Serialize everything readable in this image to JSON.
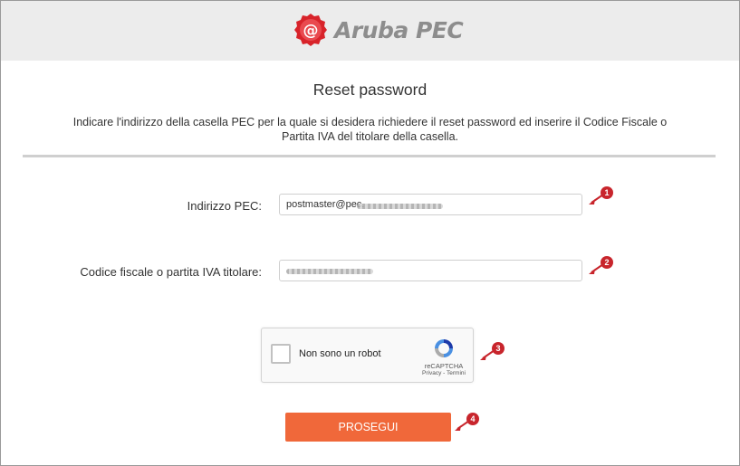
{
  "brand": {
    "name": "Aruba PEC",
    "logo_icon": "at-sign-seal-icon"
  },
  "page": {
    "title": "Reset password",
    "instructions": "Indicare l'indirizzo della casella PEC per la quale si desidera richiedere il reset password ed inserire il Codice Fiscale o Partita IVA del titolare della casella."
  },
  "form": {
    "pec_label": "Indirizzo PEC:",
    "pec_value": "postmaster@pec.",
    "cf_label": "Codice fiscale o partita IVA titolare:",
    "cf_value": ""
  },
  "captcha": {
    "label": "Non sono un robot",
    "brand": "reCAPTCHA",
    "links": "Privacy - Termini"
  },
  "submit_label": "PROSEGUI",
  "annotations": [
    "1",
    "2",
    "3",
    "4"
  ],
  "colors": {
    "accent": "#f0683a",
    "annotation": "#c8252c",
    "logo_red": "#d8232a",
    "header_bg": "#ececec"
  }
}
